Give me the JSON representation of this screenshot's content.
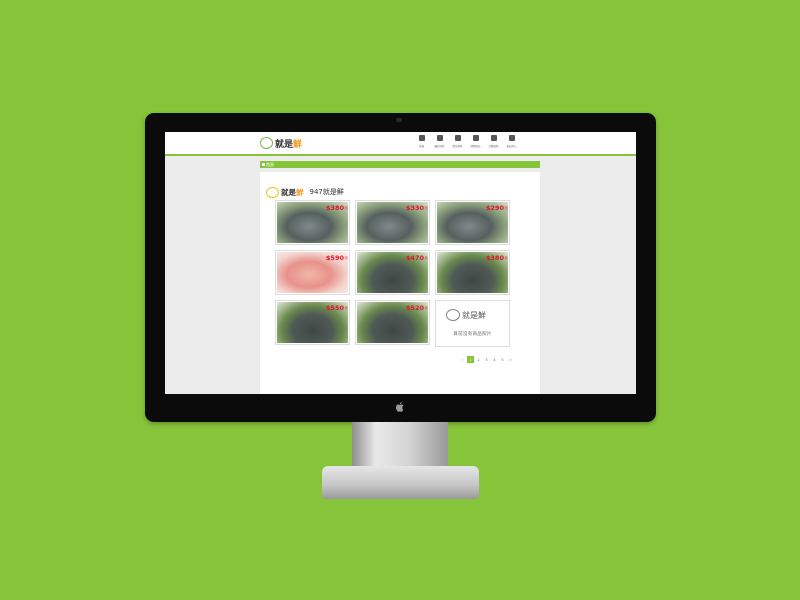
{
  "site": {
    "logo": "就是",
    "logo_fresh": "鮮"
  },
  "nav": [
    {
      "label": "首頁",
      "icon": "home-icon"
    },
    {
      "label": "最新消息",
      "icon": "calendar-icon"
    },
    {
      "label": "產品專區",
      "icon": "product-icon"
    },
    {
      "label": "搜尋商品",
      "icon": "search-icon"
    },
    {
      "label": "訂購流程",
      "icon": "cart-icon"
    },
    {
      "label": "會員中心",
      "icon": "user-icon"
    }
  ],
  "breadcrumb": {
    "label": "首頁"
  },
  "brand": {
    "logo": "就是",
    "logo_fresh": "鮮",
    "name": "947就是鮮"
  },
  "products": [
    {
      "price": "$380",
      "unit": "元"
    },
    {
      "price": "$330",
      "unit": "元"
    },
    {
      "price": "$290",
      "unit": "元"
    },
    {
      "price": "$590",
      "unit": "元"
    },
    {
      "price": "$470",
      "unit": "元"
    },
    {
      "price": "$380",
      "unit": "元"
    },
    {
      "price": "$550",
      "unit": "元"
    },
    {
      "price": "$520",
      "unit": "元"
    }
  ],
  "placeholder": {
    "brand": "就是鮮",
    "text": "目前沒有商品照片"
  },
  "pagination": {
    "prev": "‹",
    "pages": [
      "1",
      "2",
      "3",
      "4",
      "5"
    ],
    "next": "»"
  },
  "colors": {
    "accent": "#86c43a",
    "price": "#e0152a",
    "brand_orange": "#f39a1e"
  }
}
